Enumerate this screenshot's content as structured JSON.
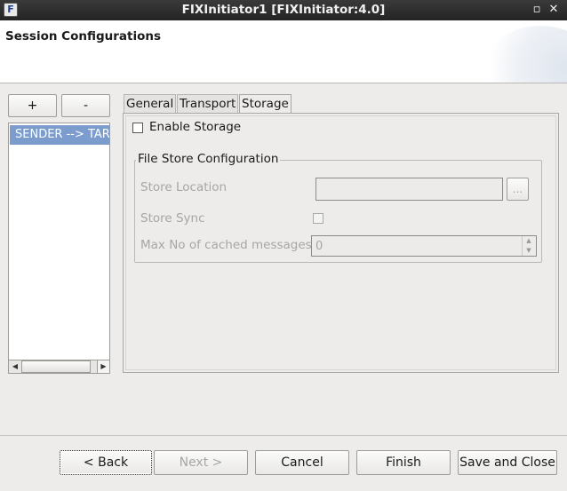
{
  "window": {
    "title": "FIXInitiator1 [FIXInitiator:4.0]",
    "app_icon_glyph": "F",
    "minimize_glyph": "▫",
    "close_glyph": "✕"
  },
  "header": {
    "title": "Session Configurations"
  },
  "sessions": {
    "add_label": "+",
    "remove_label": "-",
    "items": [
      {
        "label": "SENDER --> TARGET",
        "selected": true
      }
    ]
  },
  "tabs": [
    {
      "label": "General",
      "active": false
    },
    {
      "label": "Transport",
      "active": false
    },
    {
      "label": "Storage",
      "active": true
    }
  ],
  "storage": {
    "enable_label": "Enable Storage",
    "enable_checked": false,
    "group_title": "File Store Configuration",
    "store_location_label": "Store Location",
    "store_location_value": "",
    "browse_label": "...",
    "store_sync_label": "Store Sync",
    "store_sync_checked": false,
    "max_cached_label": "Max No of cached messages",
    "max_cached_value": "0"
  },
  "footer": {
    "back_label": "< Back",
    "next_label": "Next >",
    "cancel_label": "Cancel",
    "finish_label": "Finish",
    "save_close_label": "Save and Close"
  }
}
